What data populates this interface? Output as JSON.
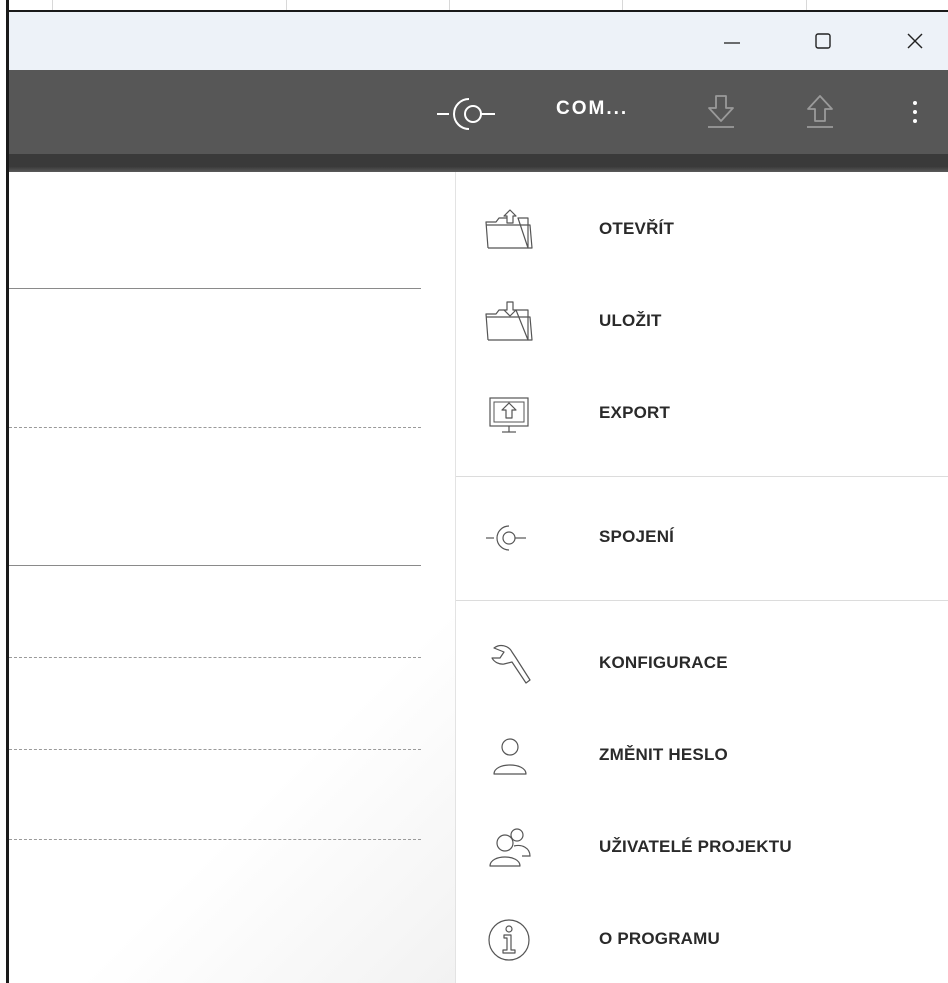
{
  "window": {
    "controls": {
      "minimize_icon": "minimize-icon",
      "maximize_icon": "maximize-icon",
      "close_icon": "close-icon"
    }
  },
  "appbar": {
    "connection_icon": "connection-icon",
    "port_label": "COM...",
    "download_icon": "download-arrow-icon",
    "upload_icon": "upload-arrow-icon",
    "more_icon": "more-vertical-icon",
    "background": "#575757"
  },
  "menu": {
    "items": [
      {
        "id": "open",
        "label": "OTEVŘÍT",
        "icon": "folder-open-icon"
      },
      {
        "id": "save",
        "label": "ULOŽIT",
        "icon": "folder-save-icon"
      },
      {
        "id": "export",
        "label": "EXPORT",
        "icon": "export-monitor-icon"
      },
      {
        "id": "connection",
        "label": "SPOJENÍ",
        "icon": "connection-icon"
      },
      {
        "id": "configuration",
        "label": "KONFIGURACE",
        "icon": "wrench-icon"
      },
      {
        "id": "change-password",
        "label": "ZMĚNIT HESLO",
        "icon": "user-icon"
      },
      {
        "id": "project-users",
        "label": "UŽIVATELÉ PROJEKTU",
        "icon": "users-icon"
      },
      {
        "id": "about",
        "label": "O PROGRAMU",
        "icon": "info-icon"
      }
    ]
  }
}
